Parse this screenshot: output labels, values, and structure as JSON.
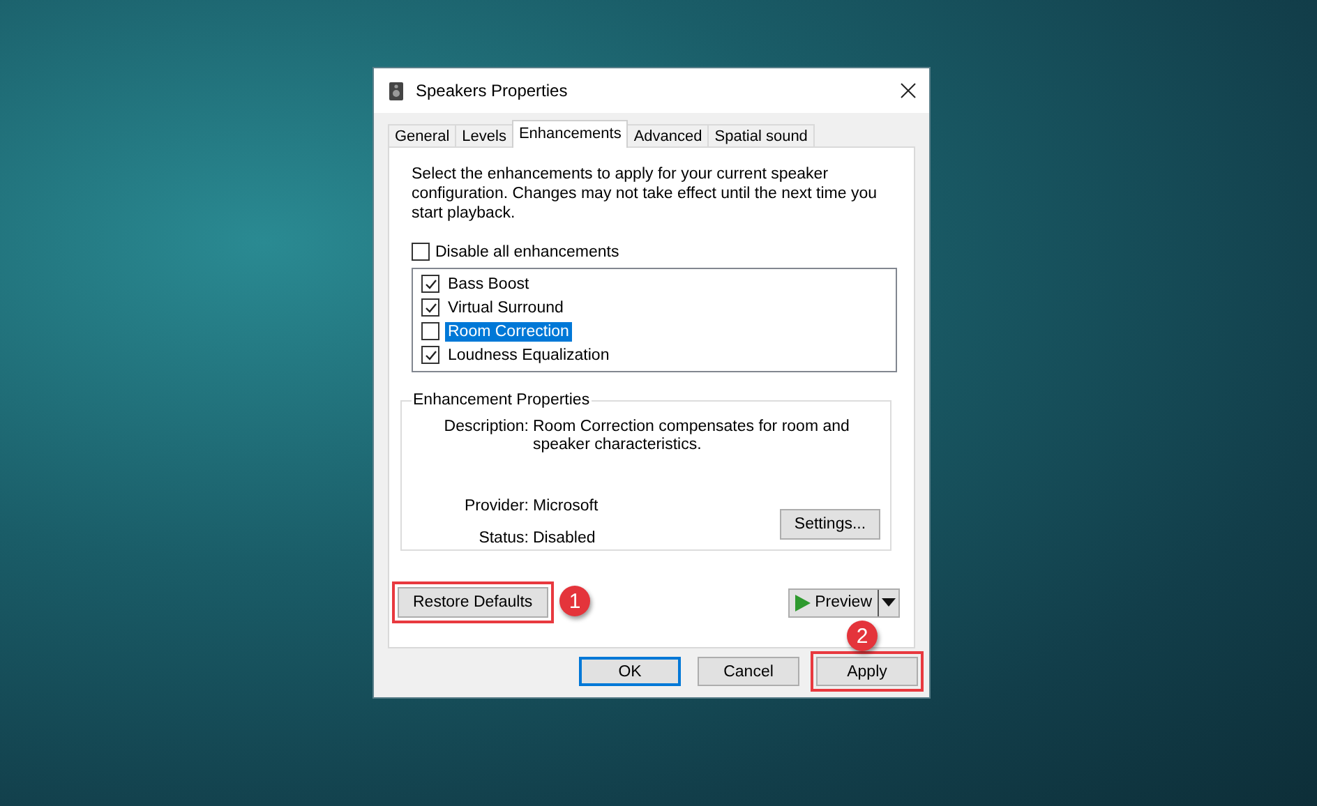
{
  "window": {
    "title": "Speakers Properties"
  },
  "tabs": [
    {
      "label": "General",
      "selected": false
    },
    {
      "label": "Levels",
      "selected": false
    },
    {
      "label": "Enhancements",
      "selected": true
    },
    {
      "label": "Advanced",
      "selected": false
    },
    {
      "label": "Spatial sound",
      "selected": false
    }
  ],
  "intro": "Select the enhancements to apply for your current speaker configuration. Changes may not take effect until the next time you start playback.",
  "disable_all": {
    "label": "Disable all enhancements",
    "checked": false
  },
  "enhancements": [
    {
      "label": "Bass Boost",
      "checked": true,
      "selected": false
    },
    {
      "label": "Virtual Surround",
      "checked": true,
      "selected": false
    },
    {
      "label": "Room Correction",
      "checked": false,
      "selected": true
    },
    {
      "label": "Loudness Equalization",
      "checked": true,
      "selected": false
    }
  ],
  "properties": {
    "title": "Enhancement Properties",
    "rows": [
      {
        "kind": "description",
        "label": "Description:",
        "value": "Room Correction compensates for room and speaker characteristics."
      },
      {
        "kind": "plain",
        "label": "Provider:",
        "value": "Microsoft"
      },
      {
        "kind": "plain",
        "label": "Status:",
        "value": "Disabled"
      }
    ],
    "settings_button": "Settings..."
  },
  "restore_defaults": {
    "label": "Restore Defaults",
    "highlighted": true,
    "callout": "1"
  },
  "preview_button": "Preview",
  "buttons": [
    {
      "label": "OK",
      "default": true,
      "highlighted": false
    },
    {
      "label": "Cancel",
      "default": false,
      "highlighted": false
    },
    {
      "label": "Apply",
      "default": false,
      "highlighted": true,
      "callout": "2"
    }
  ]
}
